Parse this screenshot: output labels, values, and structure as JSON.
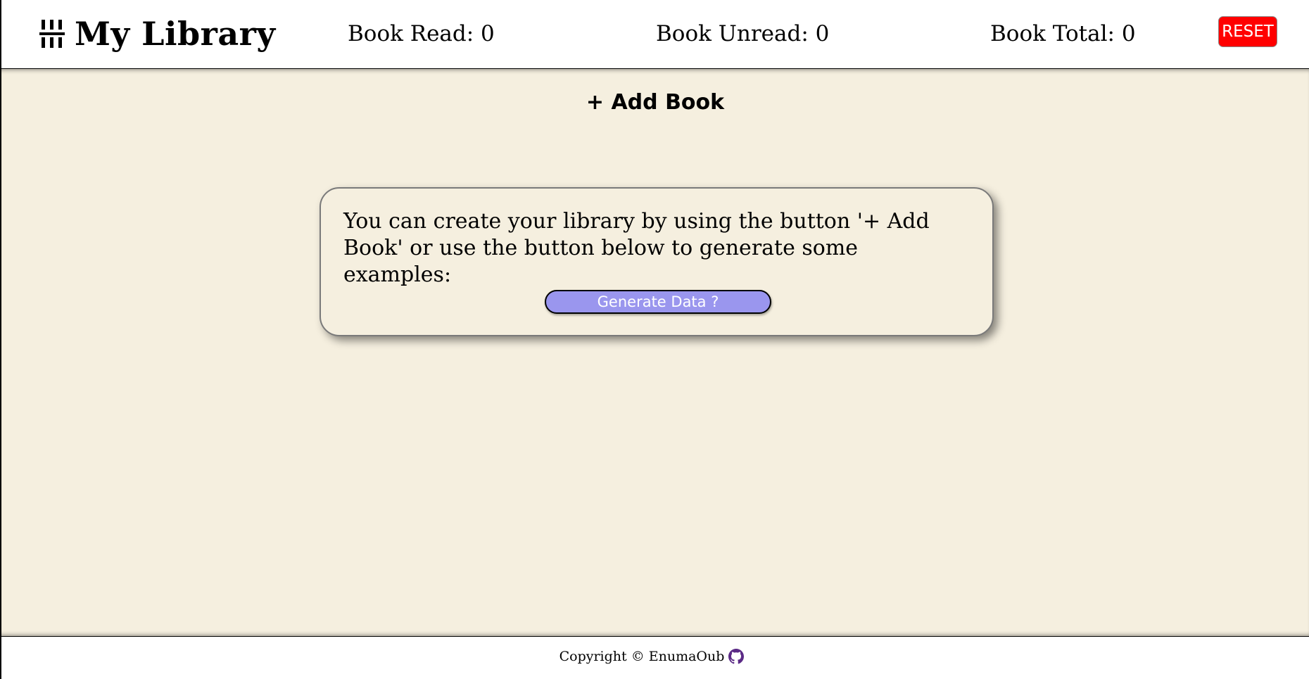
{
  "header": {
    "title": "My Library",
    "logo_icon": "books-icon",
    "stats": {
      "read_label": "Book Read: 0",
      "unread_label": "Book Unread: 0",
      "total_label": "Book Total: 0"
    },
    "reset_label": "RESET"
  },
  "main": {
    "add_book_label": "+ Add Book",
    "empty_state": {
      "message": "You can create your library by using the button '+ Add Book' or use the button below to generate some examples:",
      "generate_label": "Generate Data ?"
    }
  },
  "footer": {
    "copyright": "Copyright © EnumaOub",
    "link_icon": "github-icon"
  },
  "colors": {
    "background": "#f5efdf",
    "reset": "#ff0000",
    "generate": "#9a96ee",
    "github": "#5b2a86"
  }
}
